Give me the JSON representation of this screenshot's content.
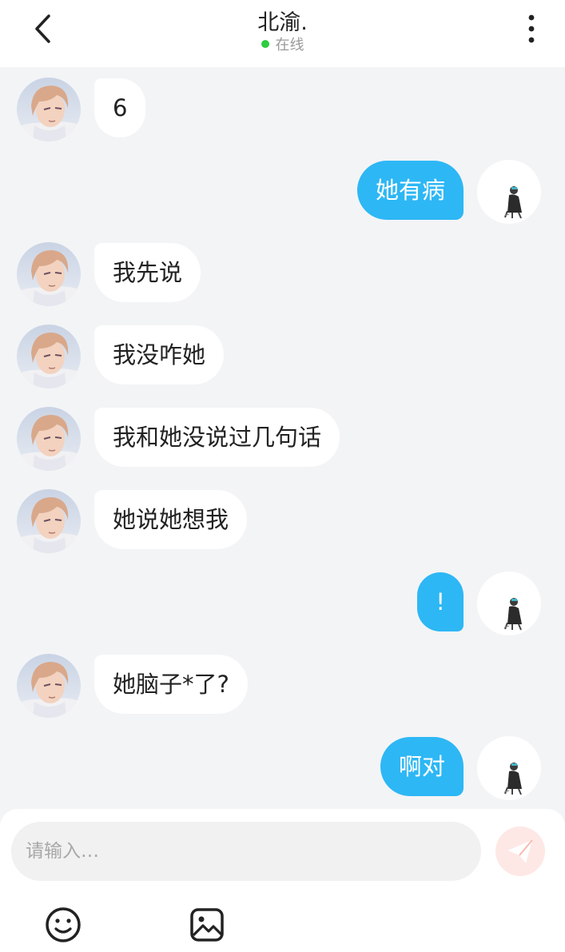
{
  "header": {
    "title": "北渝.",
    "status": "在线",
    "status_color": "#2ecc40"
  },
  "messages": [
    {
      "side": "in",
      "text": "6"
    },
    {
      "side": "out",
      "text": "她有病"
    },
    {
      "side": "in",
      "text": "我先说"
    },
    {
      "side": "in",
      "text": "我没咋她"
    },
    {
      "side": "in",
      "text": "我和她没说过几句话"
    },
    {
      "side": "in",
      "text": "她说她想我"
    },
    {
      "side": "out",
      "text": "!"
    },
    {
      "side": "in",
      "text": "她脑子*了?"
    },
    {
      "side": "out",
      "text": "啊对"
    }
  ],
  "composer": {
    "placeholder": "请输入…",
    "send_icon": "paper-plane-icon",
    "tools": [
      "emoji-icon",
      "image-icon"
    ]
  },
  "colors": {
    "accent": "#2db7f5",
    "background": "#f3f4f6",
    "send_button": "#fde8e5"
  }
}
